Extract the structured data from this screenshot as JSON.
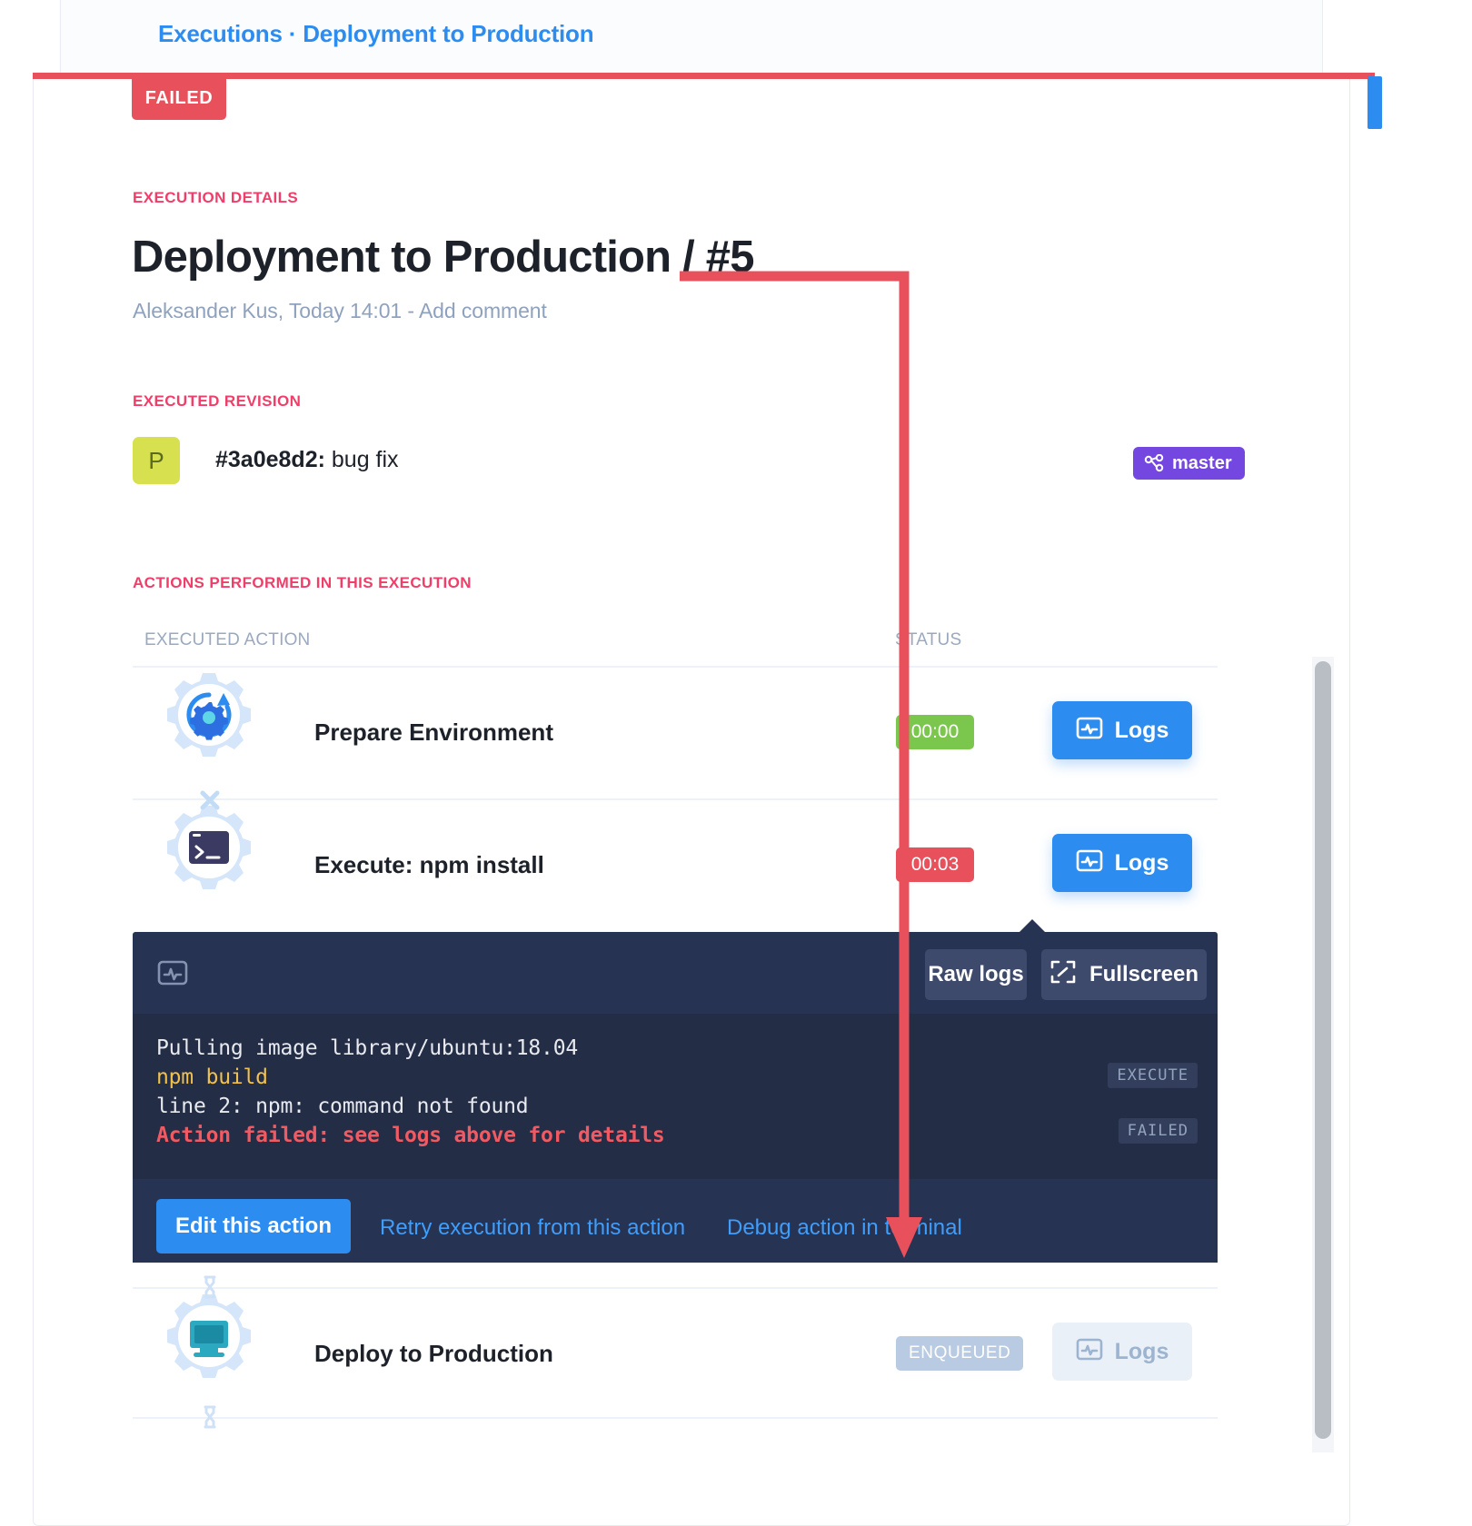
{
  "breadcrumb": {
    "text": "Executions · Deployment to Production"
  },
  "status_badge": {
    "label": "FAILED",
    "color": "#e8505b"
  },
  "execution": {
    "section_label": "EXECUTION DETAILS",
    "title": "Deployment to Production / #5",
    "byline": "Aleksander Kus, Today 14:01 - Add comment"
  },
  "revision": {
    "section_label": "EXECUTED REVISION",
    "avatar_letter": "P",
    "avatar_color": "#d7e14f",
    "hash": "#3a0e8d2:",
    "message": " bug fix",
    "branch": "master",
    "branch_color": "#7447e0",
    "branch_icon": "branch-icon"
  },
  "actions": {
    "section_label": "ACTIONS PERFORMED IN THIS EXECUTION",
    "columns": {
      "action": "EXECUTED ACTION",
      "status": "STATUS"
    },
    "logs_label": "Logs",
    "rows": [
      {
        "name": "Prepare Environment",
        "icon": "gear-refresh-icon",
        "time": "00:00",
        "time_state": "green",
        "time_color": "#7bc74d",
        "logs_enabled": true
      },
      {
        "name": "Execute: npm install",
        "icon": "gear-terminal-icon",
        "time": "00:03",
        "time_state": "red",
        "time_color": "#e8505b",
        "logs_enabled": true
      },
      {
        "name": "Deploy to Production",
        "icon": "gear-server-icon",
        "time": "ENQUEUED",
        "time_state": "grey",
        "time_color": "#b9cbe2",
        "logs_enabled": false
      }
    ],
    "connectors": [
      "x-icon",
      "hourglass-icon",
      "hourglass-icon"
    ]
  },
  "log_panel": {
    "header_icon": "logs-icon",
    "raw_logs_label": "Raw logs",
    "fullscreen_label": "Fullscreen",
    "fullscreen_icon": "fullscreen-icon",
    "lines": [
      {
        "text": "Pulling image library/ubuntu:18.04",
        "color": "#e8eaf0"
      },
      {
        "text": "npm build",
        "color": "#f2c14a"
      },
      {
        "text": "line 2: npm: command not found",
        "color": "#e8eaf0"
      },
      {
        "text": "Action failed: see logs above for details",
        "color": "#f05a63"
      }
    ],
    "tags": [
      "EXECUTE",
      "FAILED"
    ],
    "footer": {
      "edit_label": "Edit this action",
      "retry_label": "Retry execution from this action",
      "debug_label": "Debug action in terminal"
    }
  },
  "annotations": {
    "arrow_color": "#e8505b",
    "top_rule_color": "#e8505b"
  }
}
